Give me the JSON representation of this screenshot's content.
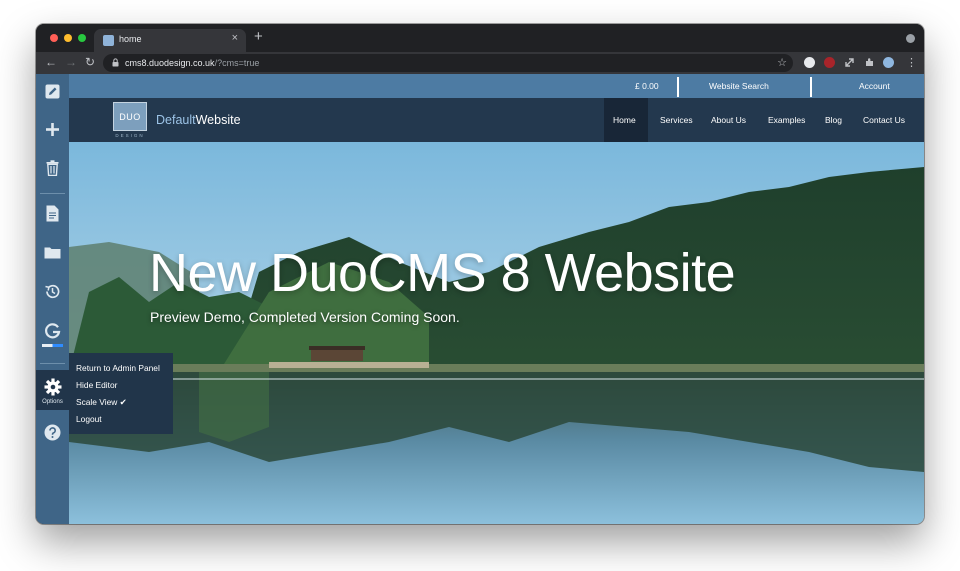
{
  "browser": {
    "tab_title": "home",
    "tab_close": "×",
    "new_tab": "+",
    "url_host": "cms8.duodesign.co.uk",
    "url_path": "/?cms=true",
    "back": "←",
    "forward": "→",
    "reload": "↻",
    "star": "☆",
    "menu": "⋮"
  },
  "cms_sidebar": {
    "icons": [
      "pencil-icon",
      "plus-icon",
      "trash-icon",
      "document-icon",
      "folder-icon",
      "history-icon",
      "grammarly-icon",
      "gear-icon",
      "help-icon"
    ],
    "options_label": "Options"
  },
  "options_menu": {
    "items": [
      "Return to Admin Panel",
      "Hide Editor",
      "Scale View ✔",
      "Logout"
    ]
  },
  "site": {
    "cart_total": "£ 0.00",
    "search_label": "Website Search",
    "account_label": "Account",
    "logo_text": "DUO",
    "logo_sub": "DESIGN",
    "name_light": "Default",
    "name_bold": "Website",
    "nav": [
      "Home",
      "Services",
      "About Us",
      "Examples",
      "Blog",
      "Contact Us"
    ],
    "hero_title": "New DuoCMS 8 Website",
    "hero_subtitle": "Preview Demo, Completed Version Coming Soon."
  },
  "colors": {
    "sidebar": "#3f6587",
    "topbar": "#4d7ba3",
    "nav_bg": "#23384e",
    "menu_bg": "#21354a"
  }
}
